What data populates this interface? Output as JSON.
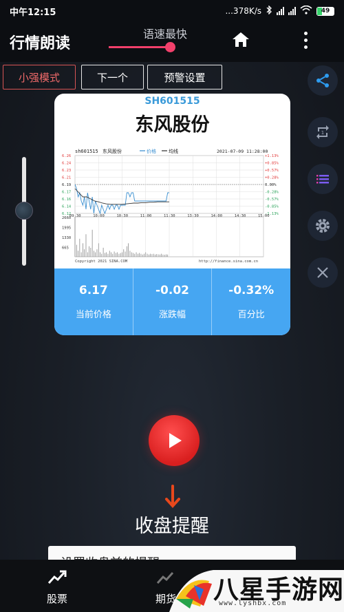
{
  "status_bar": {
    "time": "中午12:15",
    "network_speed": "...378K/s",
    "battery": "49"
  },
  "app_bar": {
    "title": "行情朗读",
    "speed_label": "语速最快",
    "speed_level": 0.87
  },
  "mode_buttons": [
    "小强模式",
    "下一个",
    "预警设置"
  ],
  "volume_level": 0.5,
  "stock": {
    "code": "SH601515",
    "name": "东风股份",
    "price": "6.17",
    "change": "-0.02",
    "change_pct": "-0.32%",
    "price_label": "当前价格",
    "change_label": "涨跌幅",
    "change_pct_label": "百分比"
  },
  "chart_data": {
    "type": "line",
    "header_code": "sh601515",
    "header_name": "东风股份",
    "legend": [
      "价格",
      "均线"
    ],
    "timestamp": "2021-07-09 11:28:00",
    "source": "Copyright 2021 SINA.COM",
    "url": "http://finance.sina.com.cn",
    "x_ticks": [
      "09:30",
      "10:00",
      "10:30",
      "11:00",
      "11:30",
      "13:30",
      "14:00",
      "14:30",
      "15:00"
    ],
    "y_left_ticks": [
      "6.26",
      "6.24",
      "6.23",
      "6.21",
      "6.19",
      "6.17",
      "6.16",
      "6.14",
      "6.12"
    ],
    "y_right_ticks": [
      "+1.13%",
      "+0.85%",
      "+0.57%",
      "+0.28%",
      "0.00%",
      "-0.28%",
      "-0.57%",
      "-0.85%",
      "-1.13%"
    ],
    "volume_ticks": [
      "2660",
      "1995",
      "1330",
      "665"
    ],
    "ylim": [
      6.12,
      6.26
    ],
    "series": [
      {
        "name": "价格",
        "x": [
          0,
          2,
          4,
          6,
          8,
          10,
          12,
          14,
          16,
          18,
          20,
          22,
          24,
          26,
          28,
          30,
          32,
          34,
          36,
          38,
          40,
          42,
          44,
          46,
          48,
          50,
          52,
          54,
          56,
          58,
          60,
          62,
          64,
          66,
          68,
          70,
          72,
          74,
          76,
          78,
          80,
          82,
          84,
          86,
          88,
          90,
          92,
          94,
          96,
          98,
          100,
          102,
          104,
          106,
          108,
          110,
          112,
          114,
          116,
          118,
          120
        ],
        "values": [
          6.19,
          6.18,
          6.16,
          6.17,
          6.15,
          6.14,
          6.16,
          6.13,
          6.17,
          6.15,
          6.13,
          6.16,
          6.12,
          6.15,
          6.14,
          6.13,
          6.12,
          6.14,
          6.13,
          6.12,
          6.13,
          6.14,
          6.13,
          6.14,
          6.14,
          6.13,
          6.14,
          6.14,
          6.13,
          6.14,
          6.14,
          6.14,
          6.14,
          6.17,
          6.17,
          6.16,
          6.17,
          6.17,
          6.15,
          6.15,
          6.15,
          6.15,
          6.15,
          6.15,
          6.15,
          6.15,
          6.15,
          6.15,
          6.15,
          6.15,
          6.15,
          6.15,
          6.15,
          6.15,
          6.15,
          6.15,
          6.15,
          6.15,
          6.15,
          6.17,
          6.17
        ]
      },
      {
        "name": "均线",
        "x": [
          0,
          5,
          10,
          15,
          20,
          25,
          30,
          35,
          40,
          45,
          50,
          55,
          60,
          65,
          70,
          75,
          80,
          85,
          90,
          95,
          100,
          105,
          110,
          115,
          120
        ],
        "values": [
          6.18,
          6.17,
          6.16,
          6.16,
          6.155,
          6.15,
          6.148,
          6.145,
          6.143,
          6.142,
          6.142,
          6.142,
          6.142,
          6.143,
          6.144,
          6.145,
          6.145,
          6.146,
          6.146,
          6.147,
          6.147,
          6.148,
          6.148,
          6.148,
          6.148
        ]
      }
    ],
    "volume": [
      2660,
      800,
      400,
      1200,
      300,
      900,
      500,
      1500,
      300,
      700,
      600,
      1800,
      400,
      300,
      500,
      900,
      300,
      200,
      600,
      250,
      300,
      200,
      400,
      300,
      200,
      350,
      250,
      300,
      200,
      250,
      300,
      500,
      350,
      700,
      900,
      400,
      300,
      250,
      200,
      300,
      200,
      250,
      200,
      150,
      200,
      300,
      200,
      150,
      200,
      180,
      200,
      150,
      180,
      160,
      150,
      200,
      150,
      140,
      160,
      150
    ]
  },
  "reminder": {
    "title": "收盘提醒",
    "placeholder": "设置收盘前的提醒"
  },
  "bottom_nav": [
    "股票",
    "期货"
  ],
  "watermark": {
    "text": "八星手游网",
    "sub": "www.lyshbx.com"
  },
  "colors": {
    "accent": "#f2406b",
    "stats_bg": "#46a6f2",
    "play": "#e22a2a",
    "code": "#3a9ad9"
  }
}
